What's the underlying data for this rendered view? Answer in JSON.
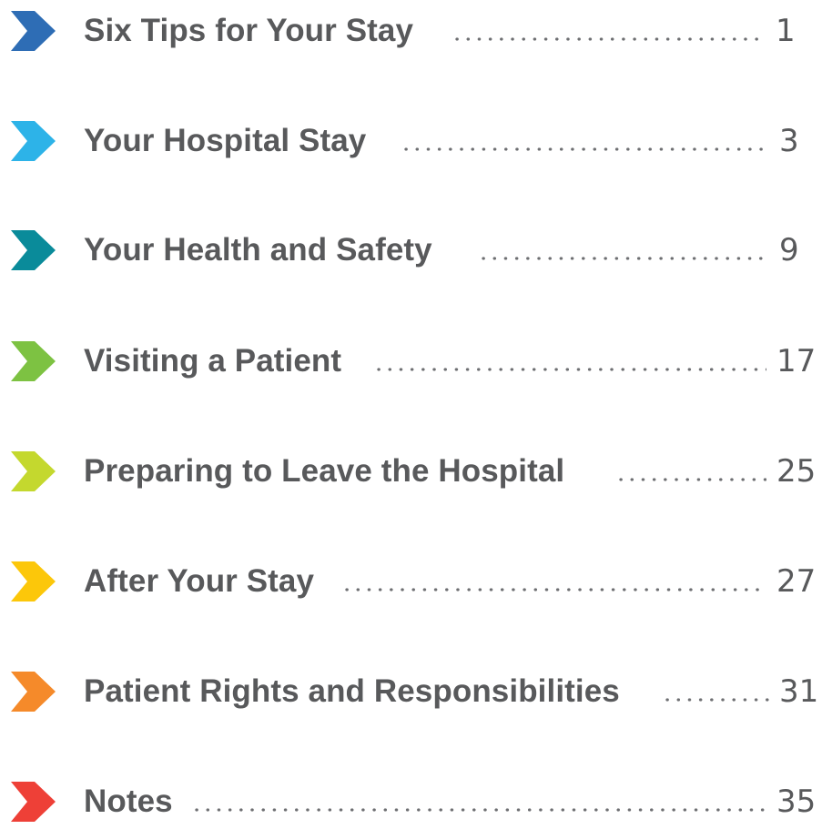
{
  "toc": {
    "entries": [
      {
        "title": "Six Tips for Your Stay",
        "page": "1",
        "icon": "chevron-right-icon",
        "color": "#2e6db5"
      },
      {
        "title": "Your Hospital Stay",
        "page": "3",
        "icon": "chevron-right-icon",
        "color": "#2db3e8"
      },
      {
        "title": "Your Health and Safety",
        "page": "9",
        "icon": "chevron-right-icon",
        "color": "#0a8b9a"
      },
      {
        "title": "Visiting a Patient",
        "page": "17",
        "icon": "chevron-right-icon",
        "color": "#7dc242"
      },
      {
        "title": "Preparing to Leave the Hospital",
        "page": "25",
        "icon": "chevron-right-icon",
        "color": "#c4d82e"
      },
      {
        "title": "After Your Stay",
        "page": "27",
        "icon": "chevron-right-icon",
        "color": "#fcc70a"
      },
      {
        "title": "Patient Rights and Responsibilities",
        "page": "31",
        "icon": "chevron-right-icon",
        "color": "#f58a2a"
      },
      {
        "title": "Notes",
        "page": "35",
        "icon": "chevron-right-icon",
        "color": "#ee4037"
      }
    ]
  }
}
